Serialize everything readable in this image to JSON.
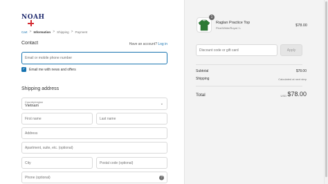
{
  "brand": {
    "logo_text": "NOAH"
  },
  "breadcrumb": {
    "items": [
      {
        "label": "Cart",
        "state": "link"
      },
      {
        "label": "Information",
        "state": "current"
      },
      {
        "label": "Shipping",
        "state": "upcoming"
      },
      {
        "label": "Payment",
        "state": "upcoming"
      }
    ],
    "separator": ">"
  },
  "contact": {
    "title": "Contact",
    "account_prompt": "Have an account?",
    "login_link": "Log in",
    "email_placeholder": "Email or mobile phone number",
    "newsletter_label": "Email me with news and offers",
    "newsletter_checked": true
  },
  "shipping": {
    "title": "Shipping address",
    "country_label": "Country/region",
    "country_value": "Vietnam",
    "first_name_placeholder": "First name",
    "last_name_placeholder": "Last name",
    "address_placeholder": "Address",
    "apartment_placeholder": "Apartment, suite, etc. (optional)",
    "city_placeholder": "City",
    "postal_placeholder": "Postal code (optional)",
    "phone_placeholder": "Phone (optional)"
  },
  "order": {
    "product": {
      "name": "Raglan Practice Top",
      "variant": "Pine/White/Royal / L",
      "price": "$78.00",
      "quantity": "1",
      "image_color": "#2d7a35"
    },
    "discount_placeholder": "Discount code or gift card",
    "apply_label": "Apply",
    "subtotal_label": "Subtotal",
    "subtotal_value": "$78.00",
    "shipping_label": "Shipping",
    "shipping_value": "Calculated at next step",
    "total_label": "Total",
    "total_currency": "USD",
    "total_value": "$78.00"
  },
  "colors": {
    "accent": "#1773b0",
    "logo_blue": "#1f2a6e",
    "logo_red": "#d42b32"
  }
}
